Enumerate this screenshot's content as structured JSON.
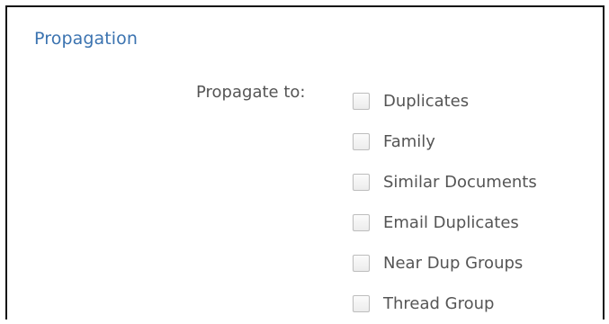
{
  "section": {
    "title": "Propagation"
  },
  "propagate": {
    "label": "Propagate to:",
    "options": [
      {
        "label": "Duplicates",
        "checked": false
      },
      {
        "label": "Family",
        "checked": false
      },
      {
        "label": "Similar Documents",
        "checked": false
      },
      {
        "label": "Email Duplicates",
        "checked": false
      },
      {
        "label": "Near Dup Groups",
        "checked": false
      },
      {
        "label": "Thread Group",
        "checked": false
      }
    ]
  },
  "colors": {
    "title": "#3b73b0",
    "text": "#555555",
    "border": "#111111",
    "checkbox_border": "#bdbdbd"
  }
}
